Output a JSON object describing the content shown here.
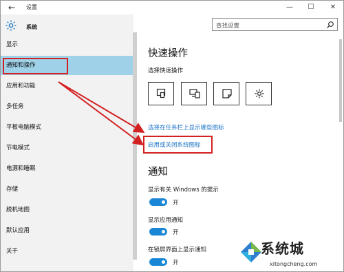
{
  "window": {
    "title": "设置",
    "controls": {
      "minimize": "—",
      "maximize": "☐",
      "close": "✕"
    },
    "back": "←"
  },
  "sidebar": {
    "header": "系统",
    "items": [
      {
        "label": "显示",
        "active": false
      },
      {
        "label": "通知和操作",
        "active": true
      },
      {
        "label": "应用和功能",
        "active": false
      },
      {
        "label": "多任务",
        "active": false
      },
      {
        "label": "平板电脑模式",
        "active": false
      },
      {
        "label": "节电模式",
        "active": false
      },
      {
        "label": "电源和睡眠",
        "active": false
      },
      {
        "label": "存储",
        "active": false
      },
      {
        "label": "脱机地图",
        "active": false
      },
      {
        "label": "默认应用",
        "active": false
      },
      {
        "label": "关于",
        "active": false
      }
    ]
  },
  "search": {
    "placeholder": "查找设置"
  },
  "main": {
    "quick_actions": {
      "title": "快速操作",
      "subtitle": "选择快速操作",
      "tiles": [
        "tablet-mode-icon",
        "project-icon",
        "note-icon",
        "settings-icon"
      ]
    },
    "links": {
      "taskbar_icons": "选择在任务栏上显示哪些图标",
      "system_icons": "启用或关闭系统图标"
    },
    "notifications": {
      "title": "通知",
      "toggles": [
        {
          "label": "显示有关 Windows 的提示",
          "state": "开",
          "on": true
        },
        {
          "label": "显示应用通知",
          "state": "开",
          "on": true
        },
        {
          "label": "在锁屏界面上显示通知",
          "state": "开",
          "on": true
        }
      ]
    }
  },
  "watermark": {
    "brand": "系统城",
    "site": "xitongcheng.com"
  },
  "colors": {
    "accent": "#1a87d6",
    "selected": "#9fd2e9",
    "link": "#1a73c7",
    "annotation": "#d32020"
  }
}
